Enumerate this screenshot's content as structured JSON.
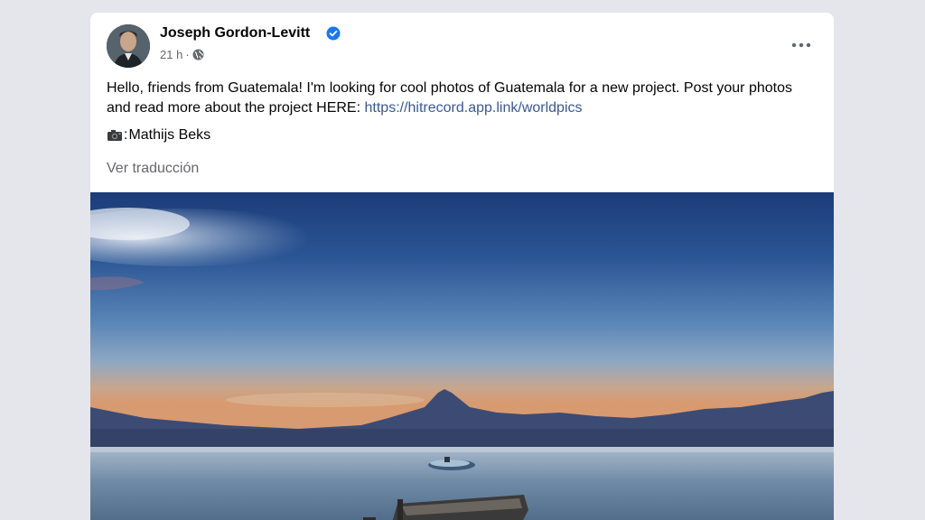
{
  "post": {
    "author": "Joseph Gordon-Levitt",
    "time": "21 h",
    "separator": "·",
    "text_main": "Hello, friends from Guatemala! I'm looking for cool photos of Guatemala for a new project. Post your photos and read more about the project HERE: ",
    "link": "https://hitrecord.app.link/worldpics",
    "credit_sep": ": ",
    "credit_name": "Mathijs Beks",
    "translate": "Ver traducción"
  },
  "icons": {
    "verified": "verified-badge-icon",
    "globe": "globe-icon",
    "more": "more-options-icon",
    "camera": "camera-icon"
  },
  "colors": {
    "background": "#e4e6eb",
    "card": "#ffffff",
    "link": "#385898",
    "verified": "#1877f2",
    "meta": "#65676b"
  }
}
